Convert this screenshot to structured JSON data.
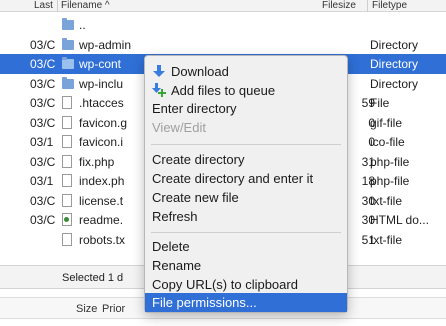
{
  "table": {
    "columns": {
      "modified": "Last",
      "filename": "Filename ^",
      "filesize": "Filesize",
      "filetype": "Filetype"
    },
    "rows": [
      {
        "date": "",
        "name": "..",
        "size": "",
        "type": "",
        "icon": "folder-icon"
      },
      {
        "date": "03/C",
        "name": "wp-admin",
        "size": "",
        "type": "Directory",
        "icon": "folder-icon"
      },
      {
        "date": "03/C",
        "name": "wp-cont",
        "size": "",
        "type": "Directory",
        "icon": "folder-icon",
        "selected": true
      },
      {
        "date": "03/C",
        "name": "wp-inclu",
        "size": "",
        "type": "Directory",
        "icon": "folder-icon"
      },
      {
        "date": "03/C",
        "name": ".htacces",
        "size": "59",
        "type": "File",
        "icon": "file-icon"
      },
      {
        "date": "03/C",
        "name": "favicon.g",
        "size": "0",
        "type": "gif-file",
        "icon": "file-icon"
      },
      {
        "date": "03/1",
        "name": "favicon.i",
        "size": "0",
        "type": "ico-file",
        "icon": "file-icon"
      },
      {
        "date": "03/C",
        "name": "fix.php",
        "size": "31",
        "type": "php-file",
        "icon": "php-icon"
      },
      {
        "date": "03/1",
        "name": "index.ph",
        "size": "18",
        "type": "php-file",
        "icon": "php-icon"
      },
      {
        "date": "03/C",
        "name": "license.t",
        "size": "30",
        "type": "txt-file",
        "icon": "file-icon"
      },
      {
        "date": "03/C",
        "name": "readme.",
        "size": "30",
        "type": "HTML do...",
        "icon": "html-icon"
      },
      {
        "date": "",
        "name": "robots.tx",
        "size": "51",
        "type": "txt-file",
        "icon": "file-icon"
      }
    ]
  },
  "status": {
    "text": "Selected 1 d"
  },
  "queue": {
    "size_label": "Size",
    "priority_label": "Prior"
  },
  "context_menu": {
    "download": "Download",
    "add_to_queue": "Add files to queue",
    "enter_directory": "Enter directory",
    "view_edit": "View/Edit",
    "create_directory": "Create directory",
    "create_directory_enter": "Create directory and enter it",
    "create_new_file": "Create new file",
    "refresh": "Refresh",
    "delete": "Delete",
    "rename": "Rename",
    "copy_urls": "Copy URL(s) to clipboard",
    "file_permissions": "File permissions..."
  },
  "colors": {
    "selection": "#2f6fd6",
    "download_arrow": "#3a7de0",
    "add_plus": "#3aa53a"
  }
}
